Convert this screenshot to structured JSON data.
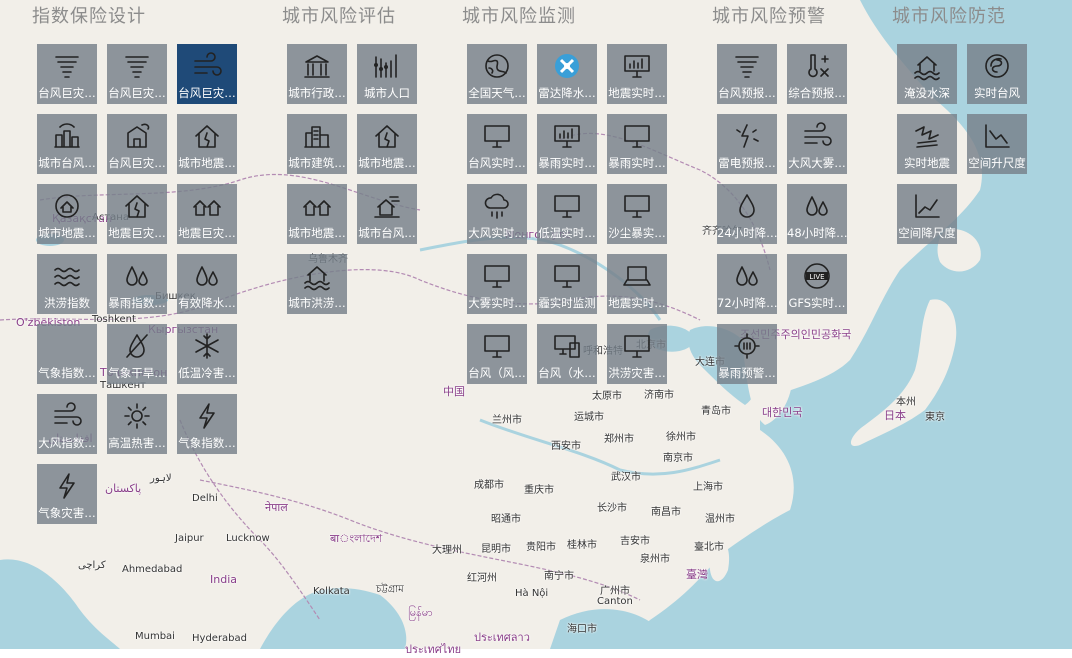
{
  "colors": {
    "water": "#aad3df",
    "land": "#f2efe9",
    "tile": "#76808a",
    "tile_active": "#1f4a78",
    "title": "#8c8c8c"
  },
  "groups": [
    {
      "id": "index",
      "title": "指数保险设计",
      "tiles": [
        {
          "label": "台风巨灾…",
          "icon": "tornado-icon"
        },
        {
          "label": "台风巨灾…",
          "icon": "tornado-icon"
        },
        {
          "label": "台风巨灾…",
          "icon": "wind-icon",
          "active": true
        },
        {
          "label": "城市台风…",
          "icon": "city-storm-icon"
        },
        {
          "label": "台风巨灾…",
          "icon": "building-storm-icon"
        },
        {
          "label": "城市地震…",
          "icon": "house-crack-icon"
        },
        {
          "label": "城市地震…",
          "icon": "globe-house-icon"
        },
        {
          "label": "地震巨灾…",
          "icon": "house-crack-icon"
        },
        {
          "label": "地震巨灾…",
          "icon": "houses-icon"
        },
        {
          "label": "洪涝指数",
          "icon": "waves-icon"
        },
        {
          "label": "暴雨指数…",
          "icon": "droplets-icon"
        },
        {
          "label": "有效降水…",
          "icon": "droplets-icon"
        },
        {
          "label": "气象指数…",
          "icon": "blank-icon"
        },
        {
          "label": "气象干旱…",
          "icon": "no-water-icon"
        },
        {
          "label": "低温冷害…",
          "icon": "snowflake-icon"
        },
        {
          "label": "大风指数…",
          "icon": "wind-icon"
        },
        {
          "label": "高温热害…",
          "icon": "sun-icon"
        },
        {
          "label": "气象指数…",
          "icon": "lightning-icon"
        },
        {
          "label": "气象灾害…",
          "icon": "lightning-icon"
        }
      ]
    },
    {
      "id": "evaluate",
      "title": "城市风险评估",
      "tiles": [
        {
          "label": "城市行政…",
          "icon": "government-icon"
        },
        {
          "label": "城市人口",
          "icon": "population-icon"
        },
        {
          "label": "城市建筑…",
          "icon": "buildings-icon"
        },
        {
          "label": "城市地震…",
          "icon": "house-crack-icon"
        },
        {
          "label": "城市地震…",
          "icon": "houses-icon"
        },
        {
          "label": "城市台风…",
          "icon": "house-wind-icon"
        },
        {
          "label": "城市洪涝…",
          "icon": "flood-house-icon"
        }
      ]
    },
    {
      "id": "monitor",
      "title": "城市风险监测",
      "tiles": [
        {
          "label": "全国天气…",
          "icon": "globe-icon"
        },
        {
          "label": "雷达降水…",
          "icon": "radar-icon"
        },
        {
          "label": "地震实时…",
          "icon": "monitor-chart-icon"
        },
        {
          "label": "台风实时…",
          "icon": "monitor-icon"
        },
        {
          "label": "暴雨实时…",
          "icon": "monitor-chart-icon"
        },
        {
          "label": "暴雨实时…",
          "icon": "monitor-icon"
        },
        {
          "label": "大风实时…",
          "icon": "cloud-rain-icon"
        },
        {
          "label": "低温实时…",
          "icon": "monitor-icon"
        },
        {
          "label": "沙尘暴实…",
          "icon": "monitor-icon"
        },
        {
          "label": "大雾实时…",
          "icon": "monitor-icon"
        },
        {
          "label": "霾实时监测",
          "icon": "monitor-icon"
        },
        {
          "label": "地震实时…",
          "icon": "laptop-icon"
        },
        {
          "label": "台风（风…",
          "icon": "monitor-icon"
        },
        {
          "label": "台风（水…",
          "icon": "devices-icon"
        },
        {
          "label": "洪涝灾害…",
          "icon": "monitor-icon"
        }
      ]
    },
    {
      "id": "warning",
      "title": "城市风险预警",
      "tiles": [
        {
          "label": "台风预报…",
          "icon": "tornado-icon"
        },
        {
          "label": "综合预报…",
          "icon": "thermometer-icon"
        },
        {
          "label": "雷电预报…",
          "icon": "thunder-icon"
        },
        {
          "label": "大风大雾…",
          "icon": "wind-icon"
        },
        {
          "label": "24小时降…",
          "icon": "drop-icon"
        },
        {
          "label": "48小时降…",
          "icon": "droplets-icon"
        },
        {
          "label": "72小时降…",
          "icon": "droplets-icon"
        },
        {
          "label": "GFS实时…",
          "icon": "live-globe-icon"
        },
        {
          "label": "暴雨预警…",
          "icon": "rain-warning-icon"
        }
      ]
    },
    {
      "id": "prevent",
      "title": "城市风险防范",
      "tiles": [
        {
          "label": "淹没水深",
          "icon": "flood-house-icon"
        },
        {
          "label": "实时台风",
          "icon": "typhoon-icon"
        },
        {
          "label": "实时地震",
          "icon": "quake-icon"
        },
        {
          "label": "空间升尺度",
          "icon": "chart-down-icon"
        },
        {
          "label": "空间降尺度",
          "icon": "chart-up-icon"
        }
      ]
    }
  ],
  "map_labels": [
    {
      "text": "Қазақстан",
      "country": true
    },
    {
      "text": "O'zbekiston",
      "country": true
    },
    {
      "text": "Toshkent"
    },
    {
      "text": "Бишкек"
    },
    {
      "text": "Кыргызстан",
      "country": true
    },
    {
      "text": "Тоҷикистон",
      "country": true
    },
    {
      "text": "افغانستان",
      "country": true
    },
    {
      "text": "پاکستان",
      "country": true
    },
    {
      "text": "لاہور"
    },
    {
      "text": "Delhi"
    },
    {
      "text": "नेपाल",
      "country": true
    },
    {
      "text": "Jaipur"
    },
    {
      "text": "Lucknow"
    },
    {
      "text": "बाংলাদেশ",
      "country": true
    },
    {
      "text": "Ahmedabad"
    },
    {
      "text": "India",
      "country": true
    },
    {
      "text": "Kolkata"
    },
    {
      "text": "Mumbai"
    },
    {
      "text": "Hyderabad"
    },
    {
      "text": "中国",
      "country": true
    },
    {
      "text": "乌鲁木齐"
    },
    {
      "text": "Монгол улс",
      "country": true
    },
    {
      "text": "兰州市"
    },
    {
      "text": "运城市"
    },
    {
      "text": "西安市"
    },
    {
      "text": "郑州市"
    },
    {
      "text": "徐州市"
    },
    {
      "text": "南京市"
    },
    {
      "text": "成都市"
    },
    {
      "text": "重庆市"
    },
    {
      "text": "武汉市"
    },
    {
      "text": "上海市"
    },
    {
      "text": "长沙市"
    },
    {
      "text": "南昌市"
    },
    {
      "text": "温州市"
    },
    {
      "text": "昭通市"
    },
    {
      "text": "贵阳市"
    },
    {
      "text": "桂林市"
    },
    {
      "text": "吉安市"
    },
    {
      "text": "大理州"
    },
    {
      "text": "昆明市"
    },
    {
      "text": "泉州市"
    },
    {
      "text": "臺北市"
    },
    {
      "text": "臺灣",
      "country": true
    },
    {
      "text": "红河州"
    },
    {
      "text": "南宁市"
    },
    {
      "text": "广州市"
    },
    {
      "text": "Canton"
    },
    {
      "text": "Hà Nội"
    },
    {
      "text": "海口市"
    },
    {
      "text": "ประเทศลาว",
      "country": true
    },
    {
      "text": "太原市"
    },
    {
      "text": "济南市"
    },
    {
      "text": "青岛市"
    },
    {
      "text": "北京市"
    },
    {
      "text": "呼和浩特"
    },
    {
      "text": "大连市"
    },
    {
      "text": "齐齐哈尔"
    },
    {
      "text": "조선민주주의인민공화국",
      "country": true
    },
    {
      "text": "대한민국",
      "country": true
    },
    {
      "text": "日本",
      "country": true
    },
    {
      "text": "東京"
    },
    {
      "text": "本州"
    },
    {
      "text": "Ташкент"
    },
    {
      "text": "Астана"
    },
    {
      "text": "كراچی"
    },
    {
      "text": "চট্টগ্রাম"
    },
    {
      "text": "မြန်မာ",
      "country": true
    },
    {
      "text": "ประเทศไทย",
      "country": true
    }
  ]
}
